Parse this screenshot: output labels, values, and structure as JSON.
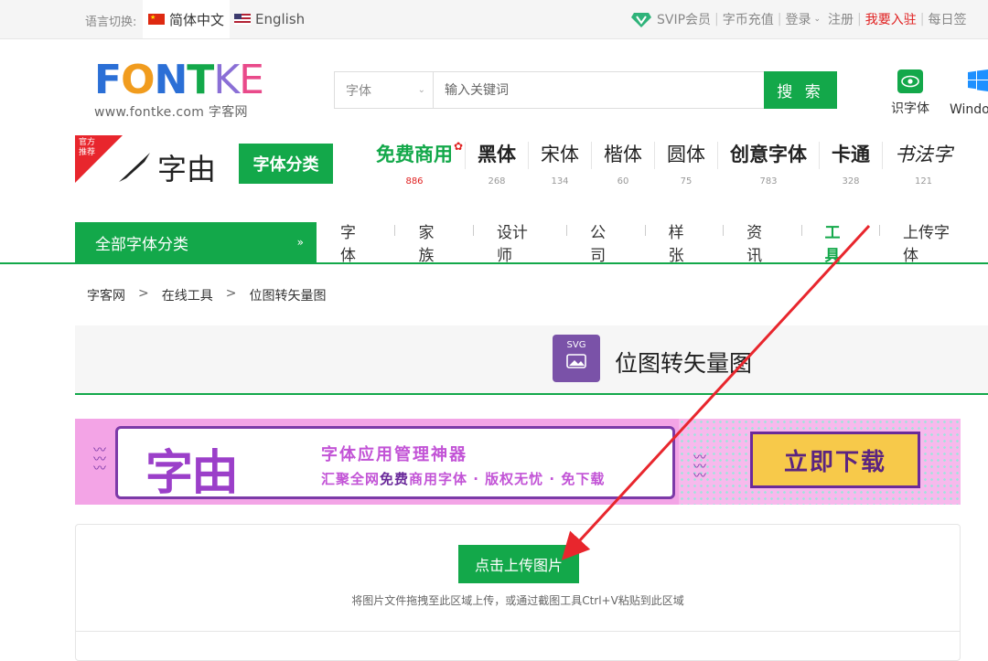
{
  "topbar": {
    "lang_label": "语言切换:",
    "lang_cn": "简体中文",
    "lang_en": "English",
    "vip": "SVIP会员",
    "recharge": "字币充值",
    "login": "登录",
    "register": "注册",
    "join": "我要入驻",
    "daily": "每日签"
  },
  "header": {
    "logo_main": "FONTKE",
    "logo_sub": "www.fontke.com 字客网",
    "search": {
      "select_value": "字体",
      "placeholder": "输入关键词",
      "button": "搜 索"
    },
    "tool_identify": "识字体",
    "tool_windows": "Windo"
  },
  "catrow": {
    "badge": "官方推荐",
    "brand": "字由",
    "category_button": "字体分类",
    "fonts": [
      {
        "name": "免费商用",
        "count": "886"
      },
      {
        "name": "黑体",
        "count": "268"
      },
      {
        "name": "宋体",
        "count": "134"
      },
      {
        "name": "楷体",
        "count": "60"
      },
      {
        "name": "圆体",
        "count": "75"
      },
      {
        "name": "创意字体",
        "count": "783"
      },
      {
        "name": "卡通",
        "count": "328"
      },
      {
        "name": "书法字",
        "count": "121"
      }
    ]
  },
  "nav": {
    "all": "全部字体分类",
    "items": [
      "字体",
      "家族",
      "设计师",
      "公司",
      "样张",
      "资讯",
      "工具",
      "上传字体"
    ],
    "active": "工具"
  },
  "breadcrumb": [
    "字客网",
    "在线工具",
    "位图转矢量图"
  ],
  "breadcrumb_sep": ">",
  "tool": {
    "icon_label": "SVG",
    "title": "位图转矢量图"
  },
  "banner": {
    "brand": "字由",
    "line1": "字体应用管理神器",
    "line2_a": "汇聚全网",
    "line2_b": "免费",
    "line2_c": "商用字体 · 版权无忧 · 免下载",
    "download": "立即下载"
  },
  "upload": {
    "button": "点击上传图片",
    "hint": "将图片文件拖拽至此区域上传，或通过截图工具Ctrl+V粘贴到此区域"
  },
  "colors": {
    "accent": "#13a84a",
    "red": "#e02020",
    "annotation_arrow": "#e8262d"
  }
}
